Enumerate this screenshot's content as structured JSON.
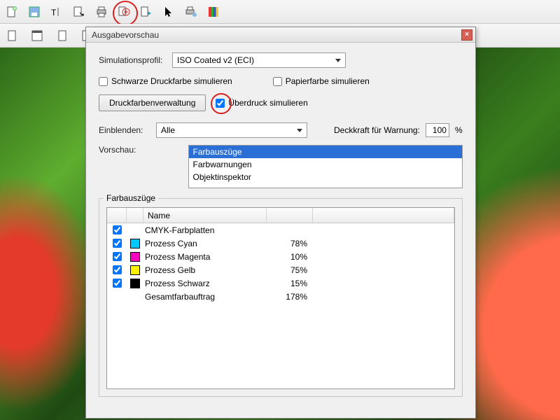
{
  "dialog": {
    "title": "Ausgabevorschau",
    "simprofile_label": "Simulationsprofil:",
    "simprofile_value": "ISO Coated v2 (ECI)",
    "chk_black": "Schwarze Druckfarbe simulieren",
    "chk_paper": "Papierfarbe simulieren",
    "btn_inkmgr": "Druckfarbenverwaltung",
    "chk_overprint": "Überdruck simulieren",
    "einblenden_label": "Einblenden:",
    "einblenden_value": "Alle",
    "deckkraft_label": "Deckkraft für Warnung:",
    "deckkraft_value": "100",
    "deckkraft_unit": "%",
    "vorschau_label": "Vorschau:",
    "vorschau_options": [
      "Farbauszüge",
      "Farbwarnungen",
      "Objektinspektor"
    ],
    "separations_legend": "Farbauszüge",
    "header_name": "Name",
    "rows": [
      {
        "checked": true,
        "swatch": "",
        "name": "CMYK-Farbplatten",
        "pct": ""
      },
      {
        "checked": true,
        "swatch": "cyan",
        "name": "Prozess Cyan",
        "pct": "78%"
      },
      {
        "checked": true,
        "swatch": "magenta",
        "name": "Prozess Magenta",
        "pct": "10%"
      },
      {
        "checked": true,
        "swatch": "yellow",
        "name": "Prozess Gelb",
        "pct": "75%"
      },
      {
        "checked": true,
        "swatch": "black",
        "name": "Prozess Schwarz",
        "pct": "15%"
      },
      {
        "checked": false,
        "swatch": "",
        "name": "Gesamtfarbauftrag",
        "pct": "178%"
      }
    ]
  }
}
